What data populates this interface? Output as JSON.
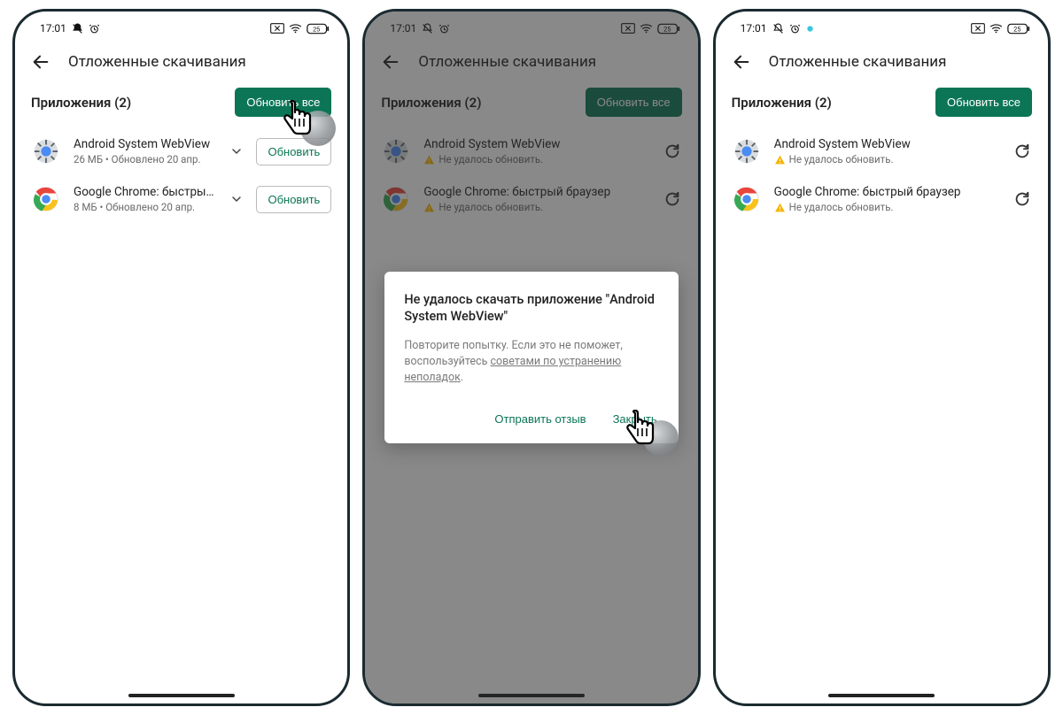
{
  "status": {
    "time": "17:01",
    "battery": "25"
  },
  "header": {
    "title": "Отложенные скачивания"
  },
  "section": {
    "title": "Приложения (2)",
    "update_all": "Обновить все"
  },
  "apps": {
    "webview": {
      "name": "Android System WebView",
      "sub_before": "26 МБ • Обновлено 20 апр.",
      "sub_fail": "Не удалось обновить.",
      "update_btn": "Обновить"
    },
    "chrome": {
      "name": "Google Chrome: быстрый браузер",
      "sub_before": "8 МБ • Обновлено 20 апр.",
      "sub_fail": "Не удалось обновить.",
      "update_btn": "Обновить"
    }
  },
  "dialog": {
    "title": "Не удалось скачать приложение \"Android System WebView\"",
    "body_lead": "Повторите попытку. Если это не поможет, воспользуйтесь ",
    "body_link": "советами по устранению неполадок",
    "body_tail": ".",
    "send": "Отправить отзыв",
    "close": "Закрыть"
  }
}
